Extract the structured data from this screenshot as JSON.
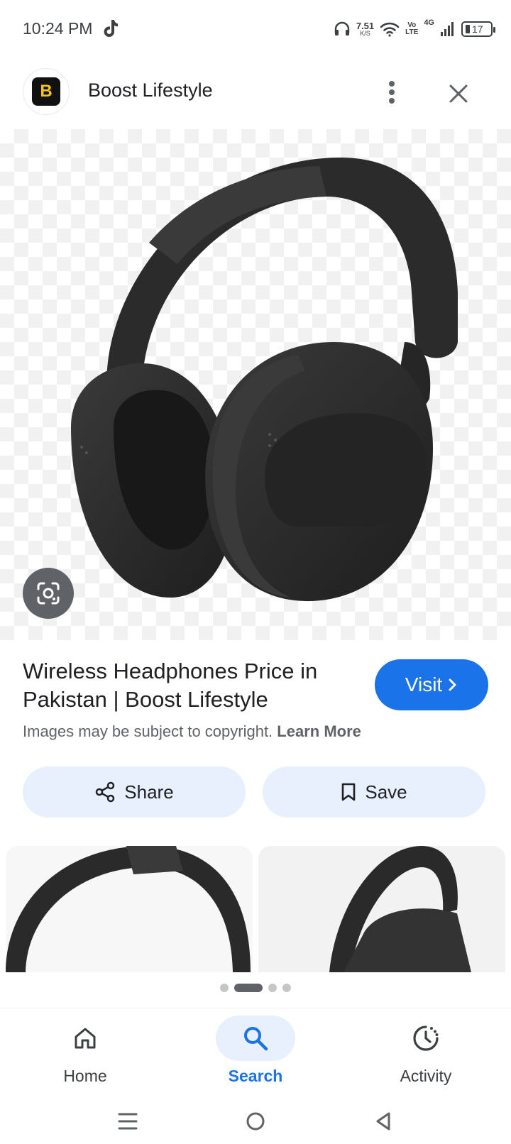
{
  "status_bar": {
    "time": "10:24 PM",
    "net_speed_value": "7.51",
    "net_speed_unit": "K/S",
    "volte_top": "Vo",
    "volte_bottom": "LTE",
    "network": "4G",
    "battery": "17"
  },
  "header": {
    "source_logo_letter": "B",
    "source_name": "Boost Lifestyle"
  },
  "result": {
    "title": "Wireless Headphones Price in Pakistan | Boost Lifestyle",
    "visit_label": "Visit",
    "copyright_text": "Images may be subject to copyright.",
    "learn_more": "Learn More"
  },
  "actions": {
    "share_label": "Share",
    "save_label": "Save"
  },
  "related": {
    "page_count": 4,
    "active_page": 2
  },
  "bottom_nav": {
    "items": [
      {
        "label": "Home",
        "icon": "home-icon"
      },
      {
        "label": "Search",
        "icon": "search-icon"
      },
      {
        "label": "Activity",
        "icon": "activity-icon"
      }
    ],
    "active": "Search"
  },
  "colors": {
    "accent": "#1a73e8",
    "action_bg": "#e8f0fe",
    "logo_bg": "#111111",
    "logo_letter": "#f7c600"
  }
}
